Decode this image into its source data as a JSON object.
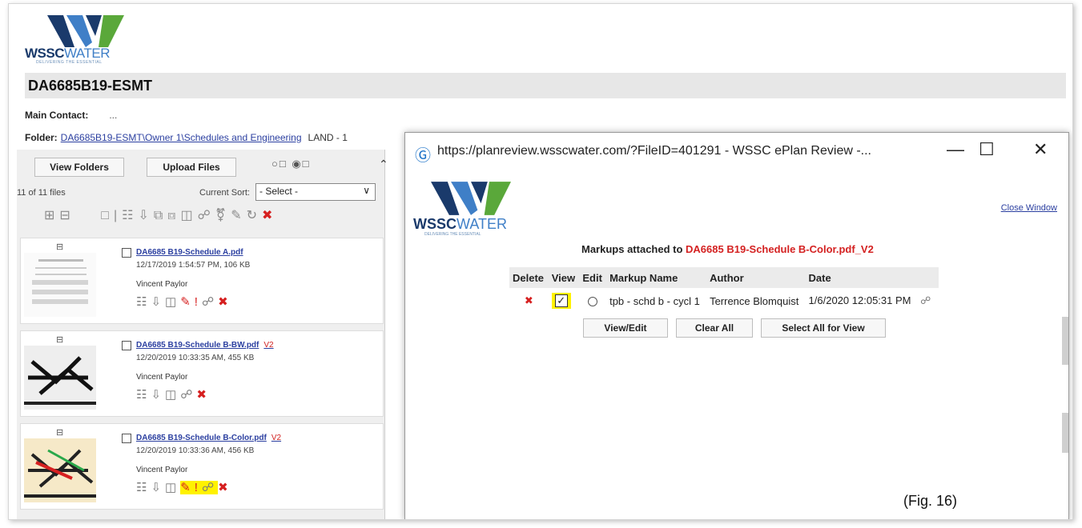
{
  "header": {
    "logo_brand": "WSSC",
    "logo_brand2": "WATER",
    "logo_tagline": "DELIVERING THE ESSENTIAL",
    "title": "DA6685B19-ESMT",
    "main_contact_label": "Main Contact:",
    "main_contact_value": "...",
    "folder_label": "Folder:",
    "folder_path": "DA6685B19-ESMT\\Owner 1\\Schedules and Engineering",
    "folder_trailing": "LAND - 1"
  },
  "files_panel": {
    "view_folders_label": "View Folders",
    "upload_files_label": "Upload Files",
    "count_text": "11 of 11 files",
    "sort_label": "Current Sort:",
    "sort_value": "- Select -",
    "files": [
      {
        "name": "DA6685 B19-Schedule A.pdf",
        "version": "",
        "meta": "12/17/2019 1:54:57 PM, 106 KB",
        "author": "Vincent Paylor"
      },
      {
        "name": "DA6685 B19-Schedule B-BW.pdf",
        "version": "V2",
        "meta": "12/20/2019 10:33:35 AM, 455 KB",
        "author": "Vincent Paylor"
      },
      {
        "name": "DA6685 B19-Schedule B-Color.pdf",
        "version": "V2",
        "meta": "12/20/2019 10:33:36 AM, 456 KB",
        "author": "Vincent Paylor"
      }
    ]
  },
  "popup": {
    "url_title": "https://planreview.wsscwater.com/?FileID=401291 - WSSC ePlan Review -...",
    "close_window_label": "Close Window",
    "heading_prefix": "Markups attached to ",
    "heading_file": "DA6685 B19-Schedule B-Color.pdf_V2",
    "columns": [
      "Delete",
      "View",
      "Edit",
      "Markup Name",
      "Author",
      "Date"
    ],
    "rows": [
      {
        "markup_name": "tpb - schd b - cycl 1",
        "author": "Terrence Blomquist",
        "date": "1/6/2020 12:05:31 PM",
        "view_checked": true
      }
    ],
    "view_edit_label": "View/Edit",
    "clear_all_label": "Clear All",
    "select_all_label": "Select All for View"
  },
  "figure_label": "(Fig. 16)",
  "colors": {
    "brand_navy": "#1a3a6b",
    "brand_blue": "#3f7fc7",
    "link": "#2b3fa0",
    "accent_red": "#d42121",
    "highlight": "#fff200"
  }
}
